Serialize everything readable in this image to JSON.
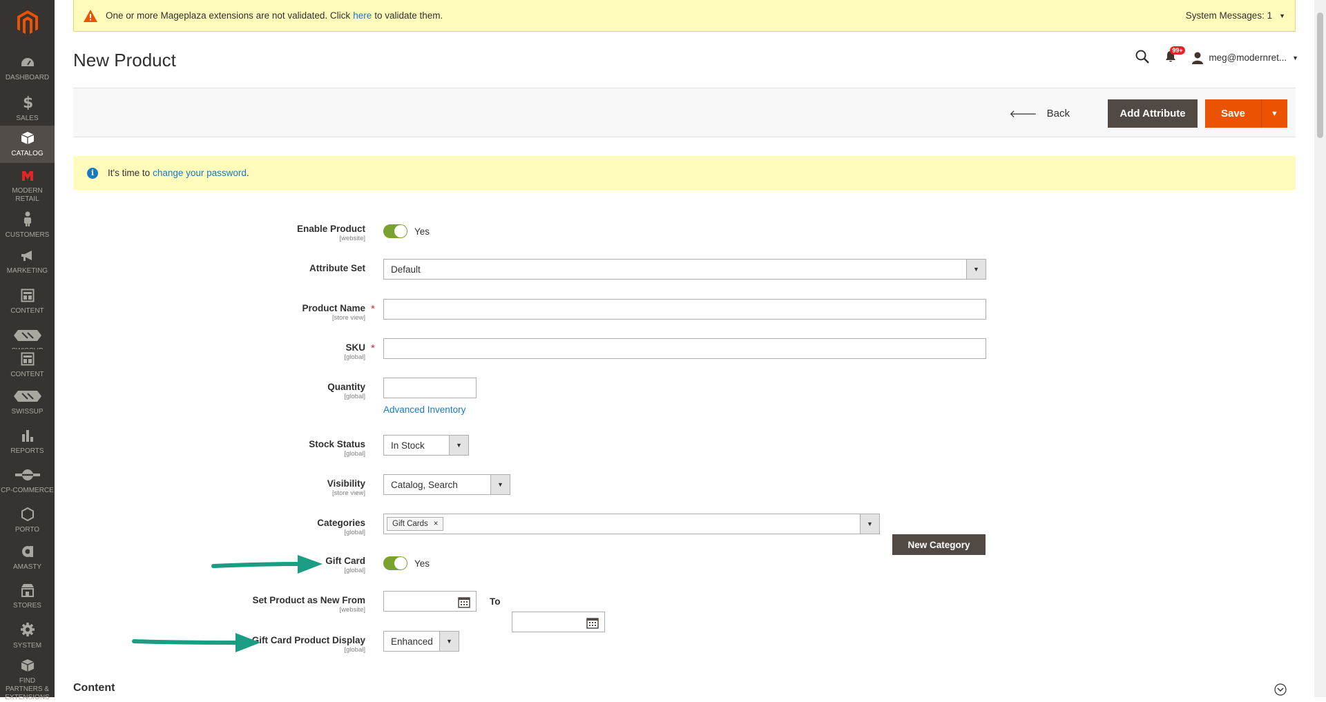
{
  "sidebar": {
    "items": [
      {
        "label": "DASHBOARD",
        "icon": "dashboard-icon"
      },
      {
        "label": "SALES",
        "icon": "dollar-icon"
      },
      {
        "label": "CATALOG",
        "icon": "cube-icon",
        "active": true
      },
      {
        "label": "MODERN RETAIL",
        "icon": "modern-retail-icon"
      },
      {
        "label": "CUSTOMERS",
        "icon": "person-icon"
      },
      {
        "label": "MARKETING",
        "icon": "megaphone-icon"
      },
      {
        "label": "CONTENT",
        "icon": "content-icon"
      },
      {
        "label": "SWISSUP",
        "icon": "swissup-icon"
      },
      {
        "label": "CONTENT",
        "icon": "content-icon"
      },
      {
        "label": "SWISSUP",
        "icon": "swissup-icon"
      },
      {
        "label": "REPORTS",
        "icon": "bar-chart-icon"
      },
      {
        "label": "CP-COMMERCE",
        "icon": "cp-commerce-icon"
      },
      {
        "label": "PORTO",
        "icon": "hexagon-icon"
      },
      {
        "label": "AMASTY",
        "icon": "amasty-icon"
      },
      {
        "label": "STORES",
        "icon": "store-icon"
      },
      {
        "label": "SYSTEM",
        "icon": "gear-icon"
      },
      {
        "label": "FIND PARTNERS & EXTENSIONS",
        "icon": "box-icon"
      }
    ]
  },
  "system_message": {
    "text_before": "One or more Mageplaza extensions are not validated. Click",
    "link": "here",
    "text_after": "to validate them.",
    "count_label": "System Messages: 1"
  },
  "header": {
    "title": "New Product",
    "notifications": "99+",
    "user": "meg@modernret..."
  },
  "actions": {
    "back": "Back",
    "add_attribute": "Add Attribute",
    "save": "Save"
  },
  "notice": {
    "text": "It's time to",
    "link": "change your password",
    "end": "."
  },
  "form": {
    "enable_product": {
      "label": "Enable Product",
      "scope": "[website]",
      "value": "Yes"
    },
    "attribute_set": {
      "label": "Attribute Set",
      "value": "Default"
    },
    "product_name": {
      "label": "Product Name",
      "scope": "[store view]",
      "value": ""
    },
    "sku": {
      "label": "SKU",
      "scope": "[global]",
      "value": ""
    },
    "quantity": {
      "label": "Quantity",
      "scope": "[global]",
      "value": "",
      "link": "Advanced Inventory"
    },
    "stock_status": {
      "label": "Stock Status",
      "scope": "[global]",
      "value": "In Stock"
    },
    "visibility": {
      "label": "Visibility",
      "scope": "[store view]",
      "value": "Catalog, Search"
    },
    "categories": {
      "label": "Categories",
      "scope": "[global]",
      "tag": "Gift Cards",
      "button": "New Category"
    },
    "gift_card": {
      "label": "Gift Card",
      "scope": "[global]",
      "value": "Yes"
    },
    "new_from": {
      "label": "Set Product as New From",
      "scope": "[website]",
      "to": "To"
    },
    "gift_card_display": {
      "label": "Gift Card Product Display",
      "scope": "[global]",
      "value": "Enhanced"
    }
  },
  "section": {
    "content_title": "Content"
  },
  "colors": {
    "accent": "#eb5202",
    "toggle_on": "#79a22e",
    "link": "#1979c3",
    "annotation_arrow": "#1a9e83"
  }
}
